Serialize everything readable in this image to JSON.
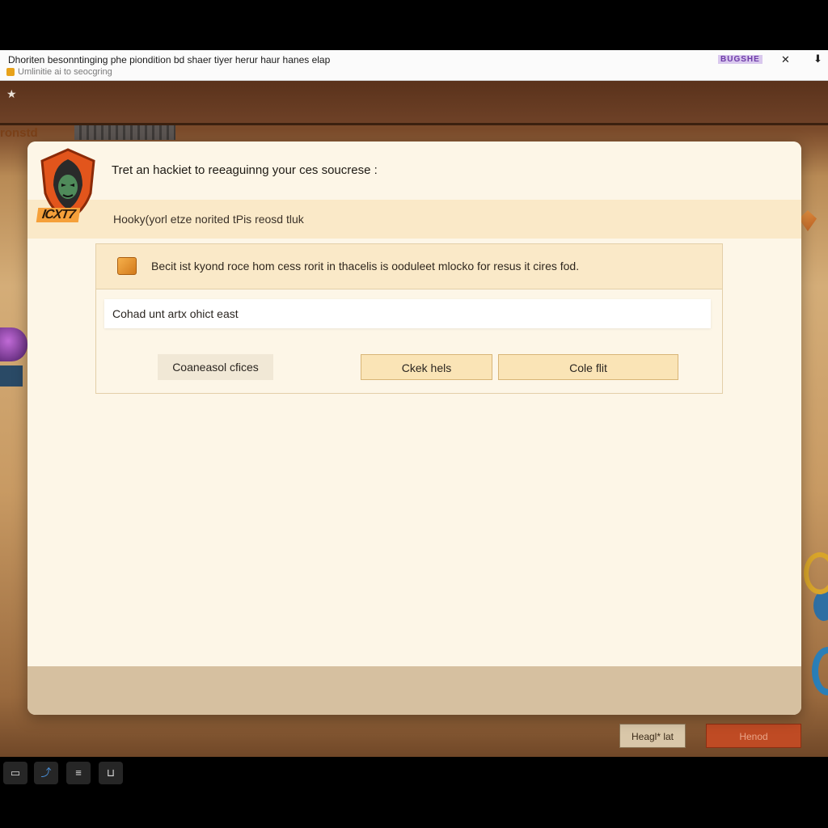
{
  "notification": {
    "title": "Dhoriten besonntinging phe piondition bd shaer tiyer herur haur hanes elap",
    "subtitle": "Umlinitie ai to seocgring",
    "badge": "BUGSHE",
    "close_glyph": "✕",
    "pin_glyph": "⬇"
  },
  "game": {
    "corner_label": "ronstd",
    "star_glyph": "★",
    "buttons": {
      "left_label": "Heagl* lat",
      "right_label": "Henod"
    }
  },
  "dialog": {
    "title": "Tret an hackiet to reeaguinng your ces soucrese :",
    "subtitle": "Hooky(yorl etze norited tPis reosd tluk",
    "logo_text": "ICXT7",
    "notice": "Becit ist kyond roce hom cess rorit in thacelis is ooduleet mlocko for resus it cires fod.",
    "input_value": "Cohad unt artx ohict east",
    "buttons": {
      "cancel": "Coaneasol cfices",
      "check": "Ckek hels",
      "code": "Cole flit"
    }
  },
  "taskbar": {
    "icons": [
      "window-icon",
      "share-icon",
      "note-icon",
      "tray-icon"
    ]
  },
  "colors": {
    "dialog_bg": "#fdf6e7",
    "accent_strip": "#fae9c8",
    "primary_button": "#fae4b6",
    "game_red_button": "#bf4b24"
  }
}
